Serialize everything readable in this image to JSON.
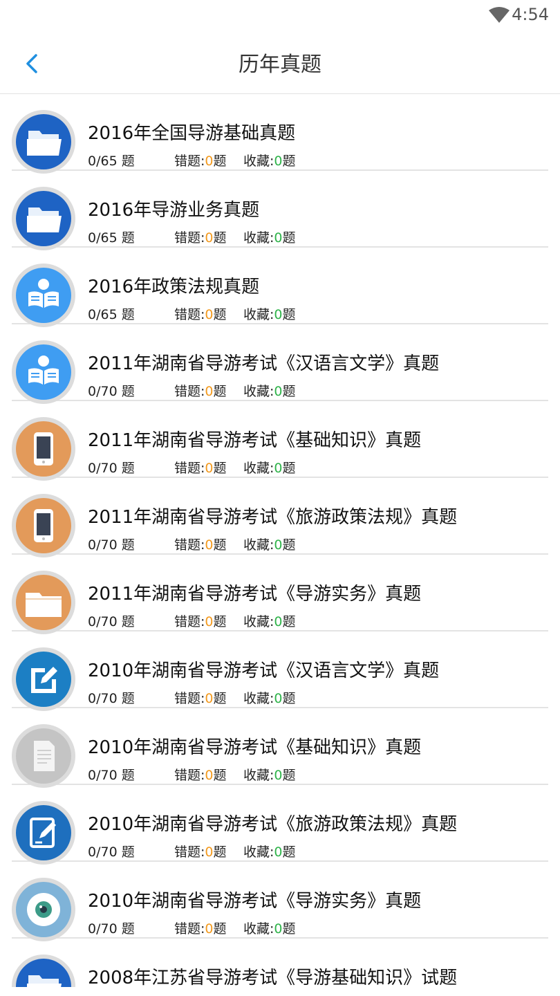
{
  "status": {
    "time": "4:54"
  },
  "header": {
    "title": "历年真题"
  },
  "colors": {
    "back": "#1f8fe0",
    "wrong_count": "#f39a1e",
    "fav_count": "#2fb34a"
  },
  "items": [
    {
      "title": "2016年全国导游基础真题",
      "progress": "0/65 题",
      "wrong_label": "错题:",
      "wrong": "0",
      "wrong_unit": "题",
      "fav_label": "收藏:",
      "fav": "0",
      "fav_unit": "题",
      "icon": "folder-icon"
    },
    {
      "title": "2016年导游业务真题",
      "progress": "0/65 题",
      "wrong_label": "错题:",
      "wrong": "0",
      "wrong_unit": "题",
      "fav_label": "收藏:",
      "fav": "0",
      "fav_unit": "题",
      "icon": "folder-icon"
    },
    {
      "title": "2016年政策法规真题",
      "progress": "0/65 题",
      "wrong_label": "错题:",
      "wrong": "0",
      "wrong_unit": "题",
      "fav_label": "收藏:",
      "fav": "0",
      "fav_unit": "题",
      "icon": "reader-icon"
    },
    {
      "title": "2011年湖南省导游考试《汉语言文学》真题",
      "progress": "0/70 题",
      "wrong_label": "错题:",
      "wrong": "0",
      "wrong_unit": "题",
      "fav_label": "收藏:",
      "fav": "0",
      "fav_unit": "题",
      "icon": "reader-icon"
    },
    {
      "title": "2011年湖南省导游考试《基础知识》真题",
      "progress": "0/70 题",
      "wrong_label": "错题:",
      "wrong": "0",
      "wrong_unit": "题",
      "fav_label": "收藏:",
      "fav": "0",
      "fav_unit": "题",
      "icon": "phone-icon"
    },
    {
      "title": "2011年湖南省导游考试《旅游政策法规》真题",
      "progress": "0/70 题",
      "wrong_label": "错题:",
      "wrong": "0",
      "wrong_unit": "题",
      "fav_label": "收藏:",
      "fav": "0",
      "fav_unit": "题",
      "icon": "phone-icon"
    },
    {
      "title": "2011年湖南省导游考试《导游实务》真题",
      "progress": "0/70 题",
      "wrong_label": "错题:",
      "wrong": "0",
      "wrong_unit": "题",
      "fav_label": "收藏:",
      "fav": "0",
      "fav_unit": "题",
      "icon": "orange-folder-icon"
    },
    {
      "title": "2010年湖南省导游考试《汉语言文学》真题",
      "progress": "0/70 题",
      "wrong_label": "错题:",
      "wrong": "0",
      "wrong_unit": "题",
      "fav_label": "收藏:",
      "fav": "0",
      "fav_unit": "题",
      "icon": "edit-icon"
    },
    {
      "title": "2010年湖南省导游考试《基础知识》真题",
      "progress": "0/70 题",
      "wrong_label": "错题:",
      "wrong": "0",
      "wrong_unit": "题",
      "fav_label": "收藏:",
      "fav": "0",
      "fav_unit": "题",
      "icon": "document-icon"
    },
    {
      "title": "2010年湖南省导游考试《旅游政策法规》真题",
      "progress": "0/70 题",
      "wrong_label": "错题:",
      "wrong": "0",
      "wrong_unit": "题",
      "fav_label": "收藏:",
      "fav": "0",
      "fav_unit": "题",
      "icon": "pen-icon"
    },
    {
      "title": "2010年湖南省导游考试《导游实务》真题",
      "progress": "0/70 题",
      "wrong_label": "错题:",
      "wrong": "0",
      "wrong_unit": "题",
      "fav_label": "收藏:",
      "fav": "0",
      "fav_unit": "题",
      "icon": "eye-icon"
    },
    {
      "title": "2008年江苏省导游考试《导游基础知识》试题",
      "progress": "",
      "wrong_label": "",
      "wrong": "",
      "wrong_unit": "",
      "fav_label": "",
      "fav": "",
      "fav_unit": "",
      "icon": "folder-icon"
    }
  ]
}
